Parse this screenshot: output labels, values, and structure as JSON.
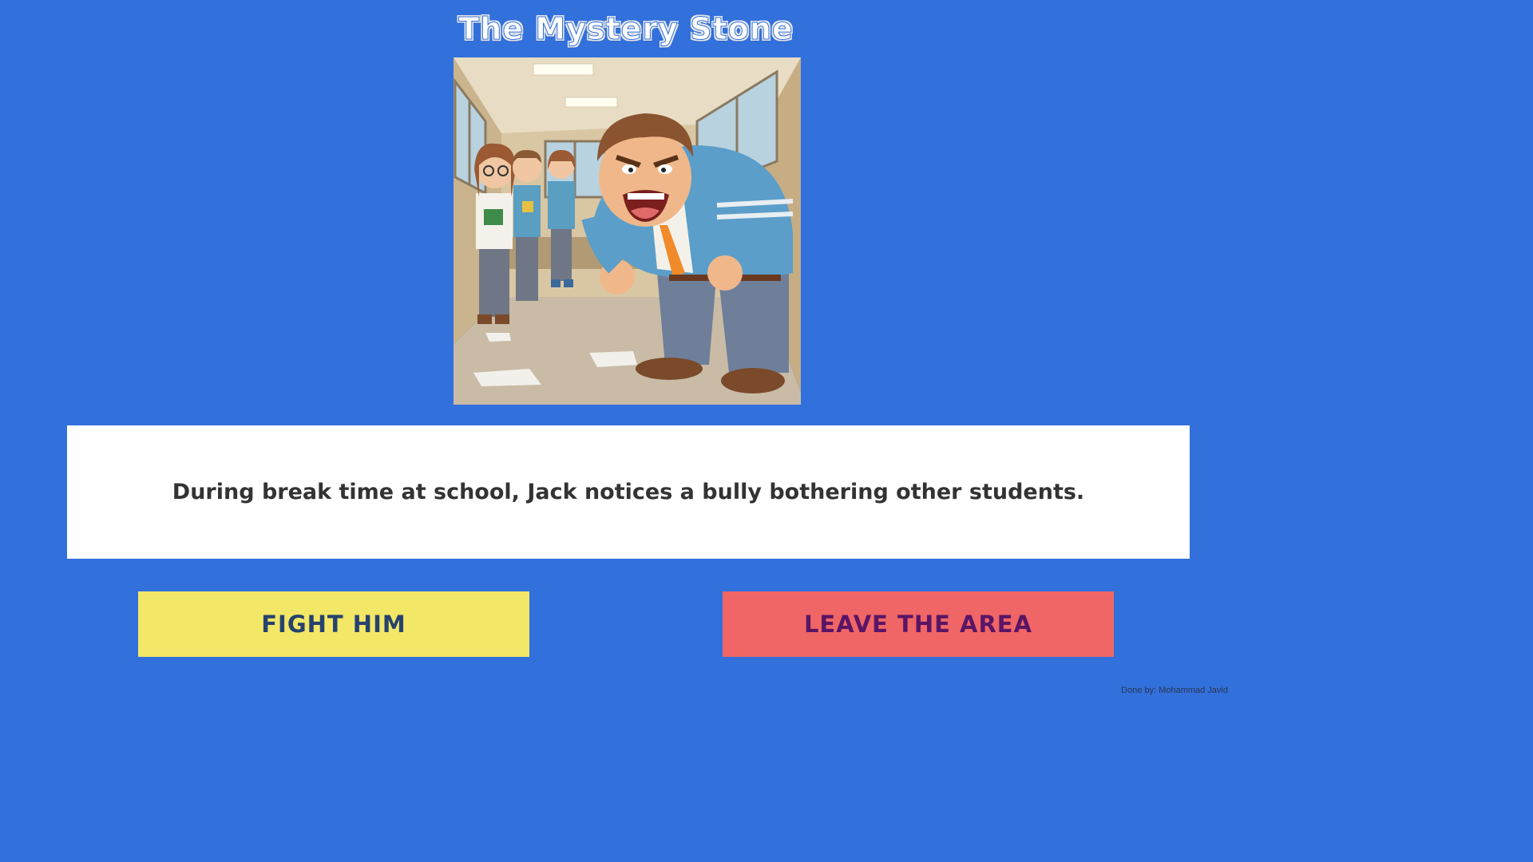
{
  "game": {
    "title": "The Mystery Stone",
    "story_text": "During break time at school, Jack notices a bully bothering other students.",
    "choices": [
      {
        "label": "Fight him"
      },
      {
        "label": "Leave the area"
      }
    ],
    "credit": "Done by: Mohammad Javid"
  },
  "colors": {
    "background": "#3270DC",
    "fight_button": "#F2E766",
    "leave_button": "#F06666",
    "textbox": "#FFFFFF"
  }
}
